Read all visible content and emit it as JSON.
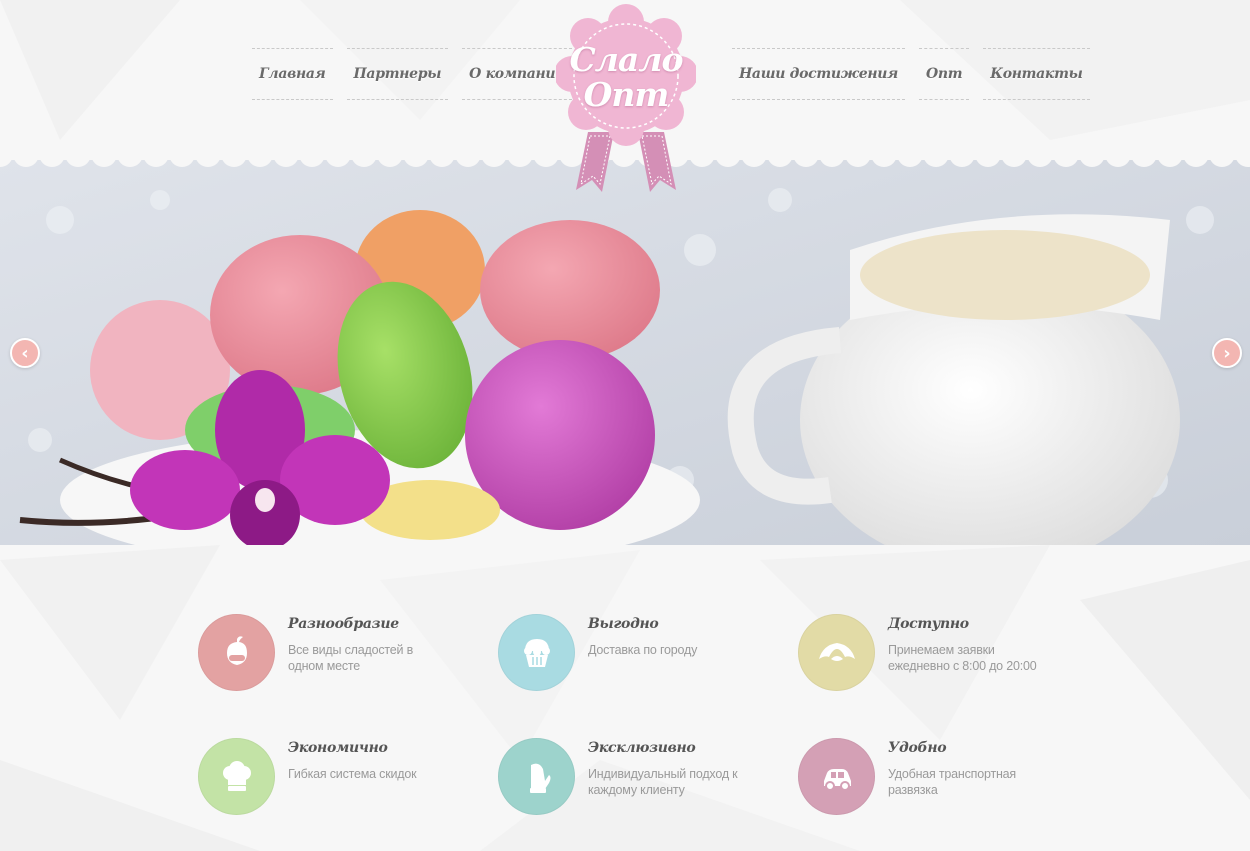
{
  "nav": {
    "left": [
      "Главная",
      "Партнеры",
      "О компании"
    ],
    "right": [
      "Наши достижения",
      "Опт",
      "Контакты"
    ]
  },
  "logo": {
    "line1": "Слало",
    "line2": "Опт"
  },
  "slider": {
    "prev_icon": "chevron-left-icon",
    "next_icon": "chevron-right-icon",
    "prev_glyph": "‹",
    "next_glyph": "›"
  },
  "features": [
    {
      "title": "Разнообразие",
      "text": "Все виды сладостей в одном месте",
      "icon": "apple-hand-icon",
      "color": "#e3a2a2"
    },
    {
      "title": "Выгодно",
      "text": "Доставка по городу",
      "icon": "cupcake-icon",
      "color": "#a9dbe2"
    },
    {
      "title": "Доступно",
      "text": "Принемаем заявки ежедневно с 8:00 до 20:00",
      "icon": "croissant-icon",
      "color": "#e2dba6"
    },
    {
      "title": "Экономично",
      "text": "Гибкая система скидок",
      "icon": "chef-hat-icon",
      "color": "#c3e3a6"
    },
    {
      "title": "Эксклюзивно",
      "text": "Индивидуальный подход к каждому клиенту",
      "icon": "oven-mitt-icon",
      "color": "#9dd3cc"
    },
    {
      "title": "Удобно",
      "text": "Удобная транспортная развязка",
      "icon": "car-icon",
      "color": "#d4a0b5"
    }
  ]
}
